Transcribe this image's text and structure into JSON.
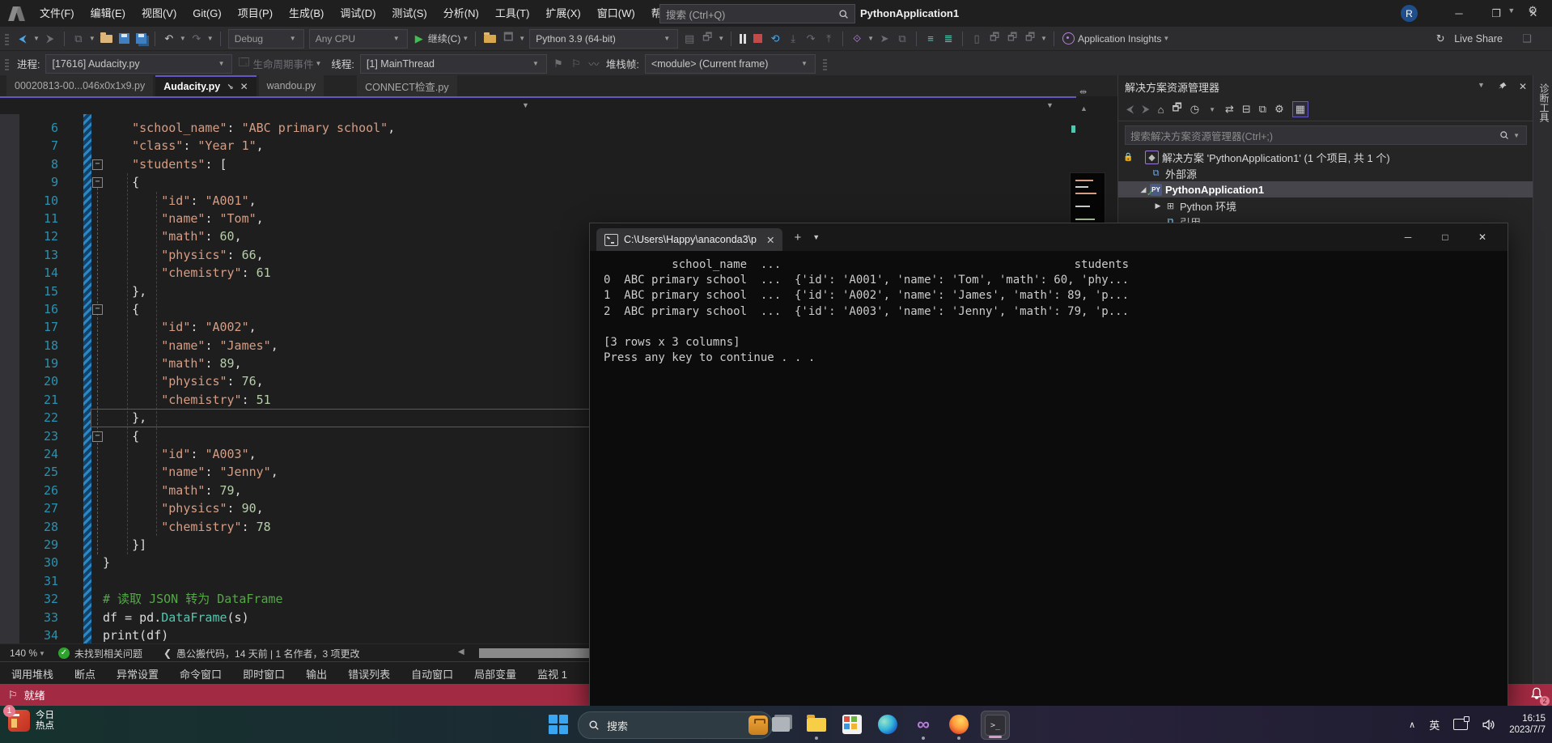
{
  "colors": {
    "accent": "#6258c5",
    "string": "#d69d85",
    "number": "#b5cea8",
    "comment": "#57a64a",
    "type": "#4ec9b0",
    "line_number": "#2b91af",
    "status_bar_red": "#a22a42",
    "console_bg": "#0c0c0c"
  },
  "titlebar": {
    "menus": [
      "文件(F)",
      "编辑(E)",
      "视图(V)",
      "Git(G)",
      "项目(P)",
      "生成(B)",
      "调试(D)",
      "测试(S)",
      "分析(N)",
      "工具(T)",
      "扩展(X)",
      "窗口(W)",
      "帮助(H)"
    ],
    "search_placeholder": "搜索 (Ctrl+Q)",
    "window_title": "PythonApplication1",
    "account_initial": "R"
  },
  "toolbar": {
    "config": "Debug",
    "platform": "Any CPU",
    "continue_label": "继续(C)",
    "python_env": "Python 3.9 (64-bit)",
    "app_insights": "Application Insights",
    "live_share": "Live Share"
  },
  "debug_location": {
    "process_label": "进程:",
    "process_value": "[17616] Audacity.py",
    "lifecycle": "生命周期事件",
    "thread_label": "线程:",
    "thread_value": "[1] MainThread",
    "frame_label": "堆栈帧:",
    "frame_value": "<module> (Current frame)"
  },
  "editor": {
    "tabs": [
      {
        "label": "00020813-00...046x0x1x9.py",
        "active": false
      },
      {
        "label": "Audacity.py",
        "active": true
      },
      {
        "label": "wandou.py",
        "active": false
      },
      {
        "label": "CONNECT检查.py",
        "active": false
      }
    ],
    "zoom": "140 %",
    "problems": "未找到相关问题",
    "codelens_prefix": "❮",
    "codelens": "愚公搬代码，14 天前 | 1 名作者，3 项更改",
    "code": [
      {
        "n": 6,
        "t": [
          [
            "pl",
            "    "
          ],
          [
            "st",
            "\"school_name\""
          ],
          [
            "pl",
            ": "
          ],
          [
            "st",
            "\"ABC primary school\""
          ],
          [
            "pl",
            ","
          ]
        ]
      },
      {
        "n": 7,
        "t": [
          [
            "pl",
            "    "
          ],
          [
            "st",
            "\"class\""
          ],
          [
            "pl",
            ": "
          ],
          [
            "st",
            "\"Year 1\""
          ],
          [
            "pl",
            ","
          ]
        ]
      },
      {
        "n": 8,
        "t": [
          [
            "pl",
            "    "
          ],
          [
            "st",
            "\"students\""
          ],
          [
            "pl",
            ": ["
          ]
        ],
        "fold": true
      },
      {
        "n": 9,
        "t": [
          [
            "pl",
            "    {"
          ]
        ],
        "fold": true
      },
      {
        "n": 10,
        "t": [
          [
            "pl",
            "        "
          ],
          [
            "st",
            "\"id\""
          ],
          [
            "pl",
            ": "
          ],
          [
            "st",
            "\"A001\""
          ],
          [
            "pl",
            ","
          ]
        ]
      },
      {
        "n": 11,
        "t": [
          [
            "pl",
            "        "
          ],
          [
            "st",
            "\"name\""
          ],
          [
            "pl",
            ": "
          ],
          [
            "st",
            "\"Tom\""
          ],
          [
            "pl",
            ","
          ]
        ]
      },
      {
        "n": 12,
        "t": [
          [
            "pl",
            "        "
          ],
          [
            "st",
            "\"math\""
          ],
          [
            "pl",
            ": "
          ],
          [
            "nu",
            "60"
          ],
          [
            "pl",
            ","
          ]
        ]
      },
      {
        "n": 13,
        "t": [
          [
            "pl",
            "        "
          ],
          [
            "st",
            "\"physics\""
          ],
          [
            "pl",
            ": "
          ],
          [
            "nu",
            "66"
          ],
          [
            "pl",
            ","
          ]
        ]
      },
      {
        "n": 14,
        "t": [
          [
            "pl",
            "        "
          ],
          [
            "st",
            "\"chemistry\""
          ],
          [
            "pl",
            ": "
          ],
          [
            "nu",
            "61"
          ]
        ]
      },
      {
        "n": 15,
        "t": [
          [
            "pl",
            "    },"
          ]
        ]
      },
      {
        "n": 16,
        "t": [
          [
            "pl",
            "    {"
          ]
        ],
        "fold": true
      },
      {
        "n": 17,
        "t": [
          [
            "pl",
            "        "
          ],
          [
            "st",
            "\"id\""
          ],
          [
            "pl",
            ": "
          ],
          [
            "st",
            "\"A002\""
          ],
          [
            "pl",
            ","
          ]
        ]
      },
      {
        "n": 18,
        "t": [
          [
            "pl",
            "        "
          ],
          [
            "st",
            "\"name\""
          ],
          [
            "pl",
            ": "
          ],
          [
            "st",
            "\"James\""
          ],
          [
            "pl",
            ","
          ]
        ]
      },
      {
        "n": 19,
        "t": [
          [
            "pl",
            "        "
          ],
          [
            "st",
            "\"math\""
          ],
          [
            "pl",
            ": "
          ],
          [
            "nu",
            "89"
          ],
          [
            "pl",
            ","
          ]
        ]
      },
      {
        "n": 20,
        "t": [
          [
            "pl",
            "        "
          ],
          [
            "st",
            "\"physics\""
          ],
          [
            "pl",
            ": "
          ],
          [
            "nu",
            "76"
          ],
          [
            "pl",
            ","
          ]
        ]
      },
      {
        "n": 21,
        "t": [
          [
            "pl",
            "        "
          ],
          [
            "st",
            "\"chemistry\""
          ],
          [
            "pl",
            ": "
          ],
          [
            "nu",
            "51"
          ]
        ]
      },
      {
        "n": 22,
        "t": [
          [
            "pl",
            "    },"
          ]
        ],
        "cur": true
      },
      {
        "n": 23,
        "t": [
          [
            "pl",
            "    {"
          ]
        ],
        "fold": true
      },
      {
        "n": 24,
        "t": [
          [
            "pl",
            "        "
          ],
          [
            "st",
            "\"id\""
          ],
          [
            "pl",
            ": "
          ],
          [
            "st",
            "\"A003\""
          ],
          [
            "pl",
            ","
          ]
        ]
      },
      {
        "n": 25,
        "t": [
          [
            "pl",
            "        "
          ],
          [
            "st",
            "\"name\""
          ],
          [
            "pl",
            ": "
          ],
          [
            "st",
            "\"Jenny\""
          ],
          [
            "pl",
            ","
          ]
        ]
      },
      {
        "n": 26,
        "t": [
          [
            "pl",
            "        "
          ],
          [
            "st",
            "\"math\""
          ],
          [
            "pl",
            ": "
          ],
          [
            "nu",
            "79"
          ],
          [
            "pl",
            ","
          ]
        ]
      },
      {
        "n": 27,
        "t": [
          [
            "pl",
            "        "
          ],
          [
            "st",
            "\"physics\""
          ],
          [
            "pl",
            ": "
          ],
          [
            "nu",
            "90"
          ],
          [
            "pl",
            ","
          ]
        ]
      },
      {
        "n": 28,
        "t": [
          [
            "pl",
            "        "
          ],
          [
            "st",
            "\"chemistry\""
          ],
          [
            "pl",
            ": "
          ],
          [
            "nu",
            "78"
          ]
        ]
      },
      {
        "n": 29,
        "t": [
          [
            "pl",
            "    }]"
          ]
        ]
      },
      {
        "n": 30,
        "t": [
          [
            "pl",
            "}"
          ]
        ]
      },
      {
        "n": 31,
        "t": []
      },
      {
        "n": 32,
        "t": [
          [
            "co",
            "# 读取 JSON 转为 DataFrame"
          ]
        ]
      },
      {
        "n": 33,
        "t": [
          [
            "pl",
            "df = pd."
          ],
          [
            "ty",
            "DataFrame"
          ],
          [
            "pl",
            "(s)"
          ]
        ]
      },
      {
        "n": 34,
        "t": [
          [
            "pl",
            "print(df)"
          ]
        ]
      }
    ]
  },
  "console": {
    "tab_title": "C:\\Users\\Happy\\anaconda3\\p",
    "lines": [
      "          school_name  ...                                           students",
      "0  ABC primary school  ...  {'id': 'A001', 'name': 'Tom', 'math': 60, 'phy...",
      "1  ABC primary school  ...  {'id': 'A002', 'name': 'James', 'math': 89, 'p...",
      "2  ABC primary school  ...  {'id': 'A003', 'name': 'Jenny', 'math': 79, 'p...",
      "",
      "[3 rows x 3 columns]",
      "Press any key to continue . . ."
    ]
  },
  "solution_explorer": {
    "title": "解决方案资源管理器",
    "search_placeholder": "搜索解决方案资源管理器(Ctrl+;)",
    "toolbar_icons": [
      "back",
      "forward",
      "home",
      "switch-views",
      "pending-changes",
      "sync-with-active-document",
      "collapse-all",
      "properties",
      "wrench",
      "show-all-files"
    ],
    "items": [
      {
        "label": "解决方案 'PythonApplication1' (1 个项目, 共 1 个)",
        "icon": "solution",
        "lock": true,
        "indent": 0
      },
      {
        "label": "外部源",
        "icon": "external",
        "indent": 1
      },
      {
        "label": "PythonApplication1",
        "icon": "pyproj",
        "indent": 1,
        "arrow": "expanded",
        "selected": true,
        "checked": true
      },
      {
        "label": "Python 环境",
        "icon": "envs",
        "indent": 2,
        "arrow": "collapsed"
      },
      {
        "label": "引用",
        "icon": "refs",
        "indent": 2
      }
    ],
    "diagnostics_tab": "诊断工具"
  },
  "panel_tabs": [
    "调用堆栈",
    "断点",
    "异常设置",
    "命令窗口",
    "即时窗口",
    "输出",
    "错误列表",
    "自动窗口",
    "局部变量",
    "监视 1"
  ],
  "statusbar": {
    "ready": "就绪",
    "bell_badge": "2"
  },
  "taskbar": {
    "widget_line1": "今日",
    "widget_line2": "热点",
    "widget_badge": "1",
    "search_placeholder": "搜索",
    "apps": [
      {
        "name": "app-window",
        "running": false,
        "active": false
      },
      {
        "name": "file-explorer",
        "running": true,
        "active": false
      },
      {
        "name": "microsoft-store",
        "running": false,
        "active": false
      },
      {
        "name": "edge",
        "running": false,
        "active": false
      },
      {
        "name": "visual-studio",
        "running": true,
        "active": false
      },
      {
        "name": "firefox",
        "running": true,
        "active": false
      },
      {
        "name": "terminal",
        "running": true,
        "active": true
      }
    ],
    "tray_lang": "英",
    "time": "16:15",
    "date": "2023/7/7"
  }
}
